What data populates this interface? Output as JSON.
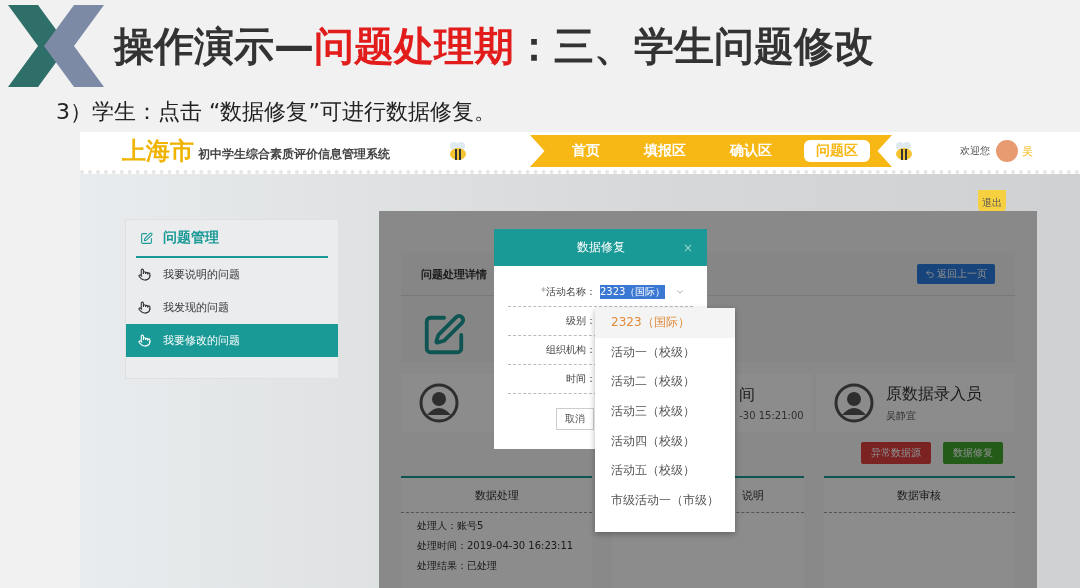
{
  "slide": {
    "title": [
      {
        "text": "操作演示—",
        "highlight": false
      },
      {
        "text": "问题处理期",
        "highlight": true
      },
      {
        "text": "：三、学生问题修改",
        "highlight": false
      }
    ],
    "subtitle": "3）学生：点击 “数据修复”可进行数据修复。"
  },
  "app": {
    "city": "上海市",
    "system_name": "初中学生综合素质评价信息管理系统",
    "nav": [
      {
        "label": "首页",
        "selected": false
      },
      {
        "label": "填报区",
        "selected": false
      },
      {
        "label": "确认区",
        "selected": false
      },
      {
        "label": "问题区",
        "selected": true
      }
    ],
    "greeting": "欢迎您",
    "user_name": "吴",
    "logout": "退出"
  },
  "sidebar": {
    "title": "问题管理",
    "items": [
      {
        "label": "我要说明的问题",
        "selected": false
      },
      {
        "label": "我发现的问题",
        "selected": false
      },
      {
        "label": "我要修改的问题",
        "selected": true
      }
    ]
  },
  "detail": {
    "title": "问题处理详情",
    "back_button": "返回上一页",
    "info_cards": [
      {
        "heading": "间",
        "value": "-30 15:21:00"
      },
      {
        "heading": "原数据录入员",
        "value": "吴静宜"
      }
    ],
    "buttons": [
      {
        "label": "异常数据源",
        "kind": "danger"
      },
      {
        "label": "数据修复",
        "kind": "success"
      }
    ],
    "panels": [
      {
        "title": "数据处理",
        "lines": [
          "处理人：账号5",
          "处理时间：2019-04-30 16:23:11",
          "处理结果：已处理"
        ]
      },
      {
        "title": "说明"
      },
      {
        "title": "数据审核"
      }
    ]
  },
  "modal": {
    "title": "数据修复",
    "close": "×",
    "fields": [
      {
        "label": "活动名称：",
        "required_mark": "*",
        "value": "2323（国际）"
      },
      {
        "label": "级别："
      },
      {
        "label": "组织机构："
      },
      {
        "label": "时间："
      }
    ],
    "cancel": "取消",
    "options": [
      {
        "label": "2323（国际）",
        "selected": true
      },
      {
        "label": "活动一（校级）",
        "selected": false
      },
      {
        "label": "活动二（校级）",
        "selected": false
      },
      {
        "label": "活动三（校级）",
        "selected": false
      },
      {
        "label": "活动四（校级）",
        "selected": false
      },
      {
        "label": "活动五（校级）",
        "selected": false
      },
      {
        "label": "市级活动一（市级）",
        "selected": false
      }
    ]
  }
}
